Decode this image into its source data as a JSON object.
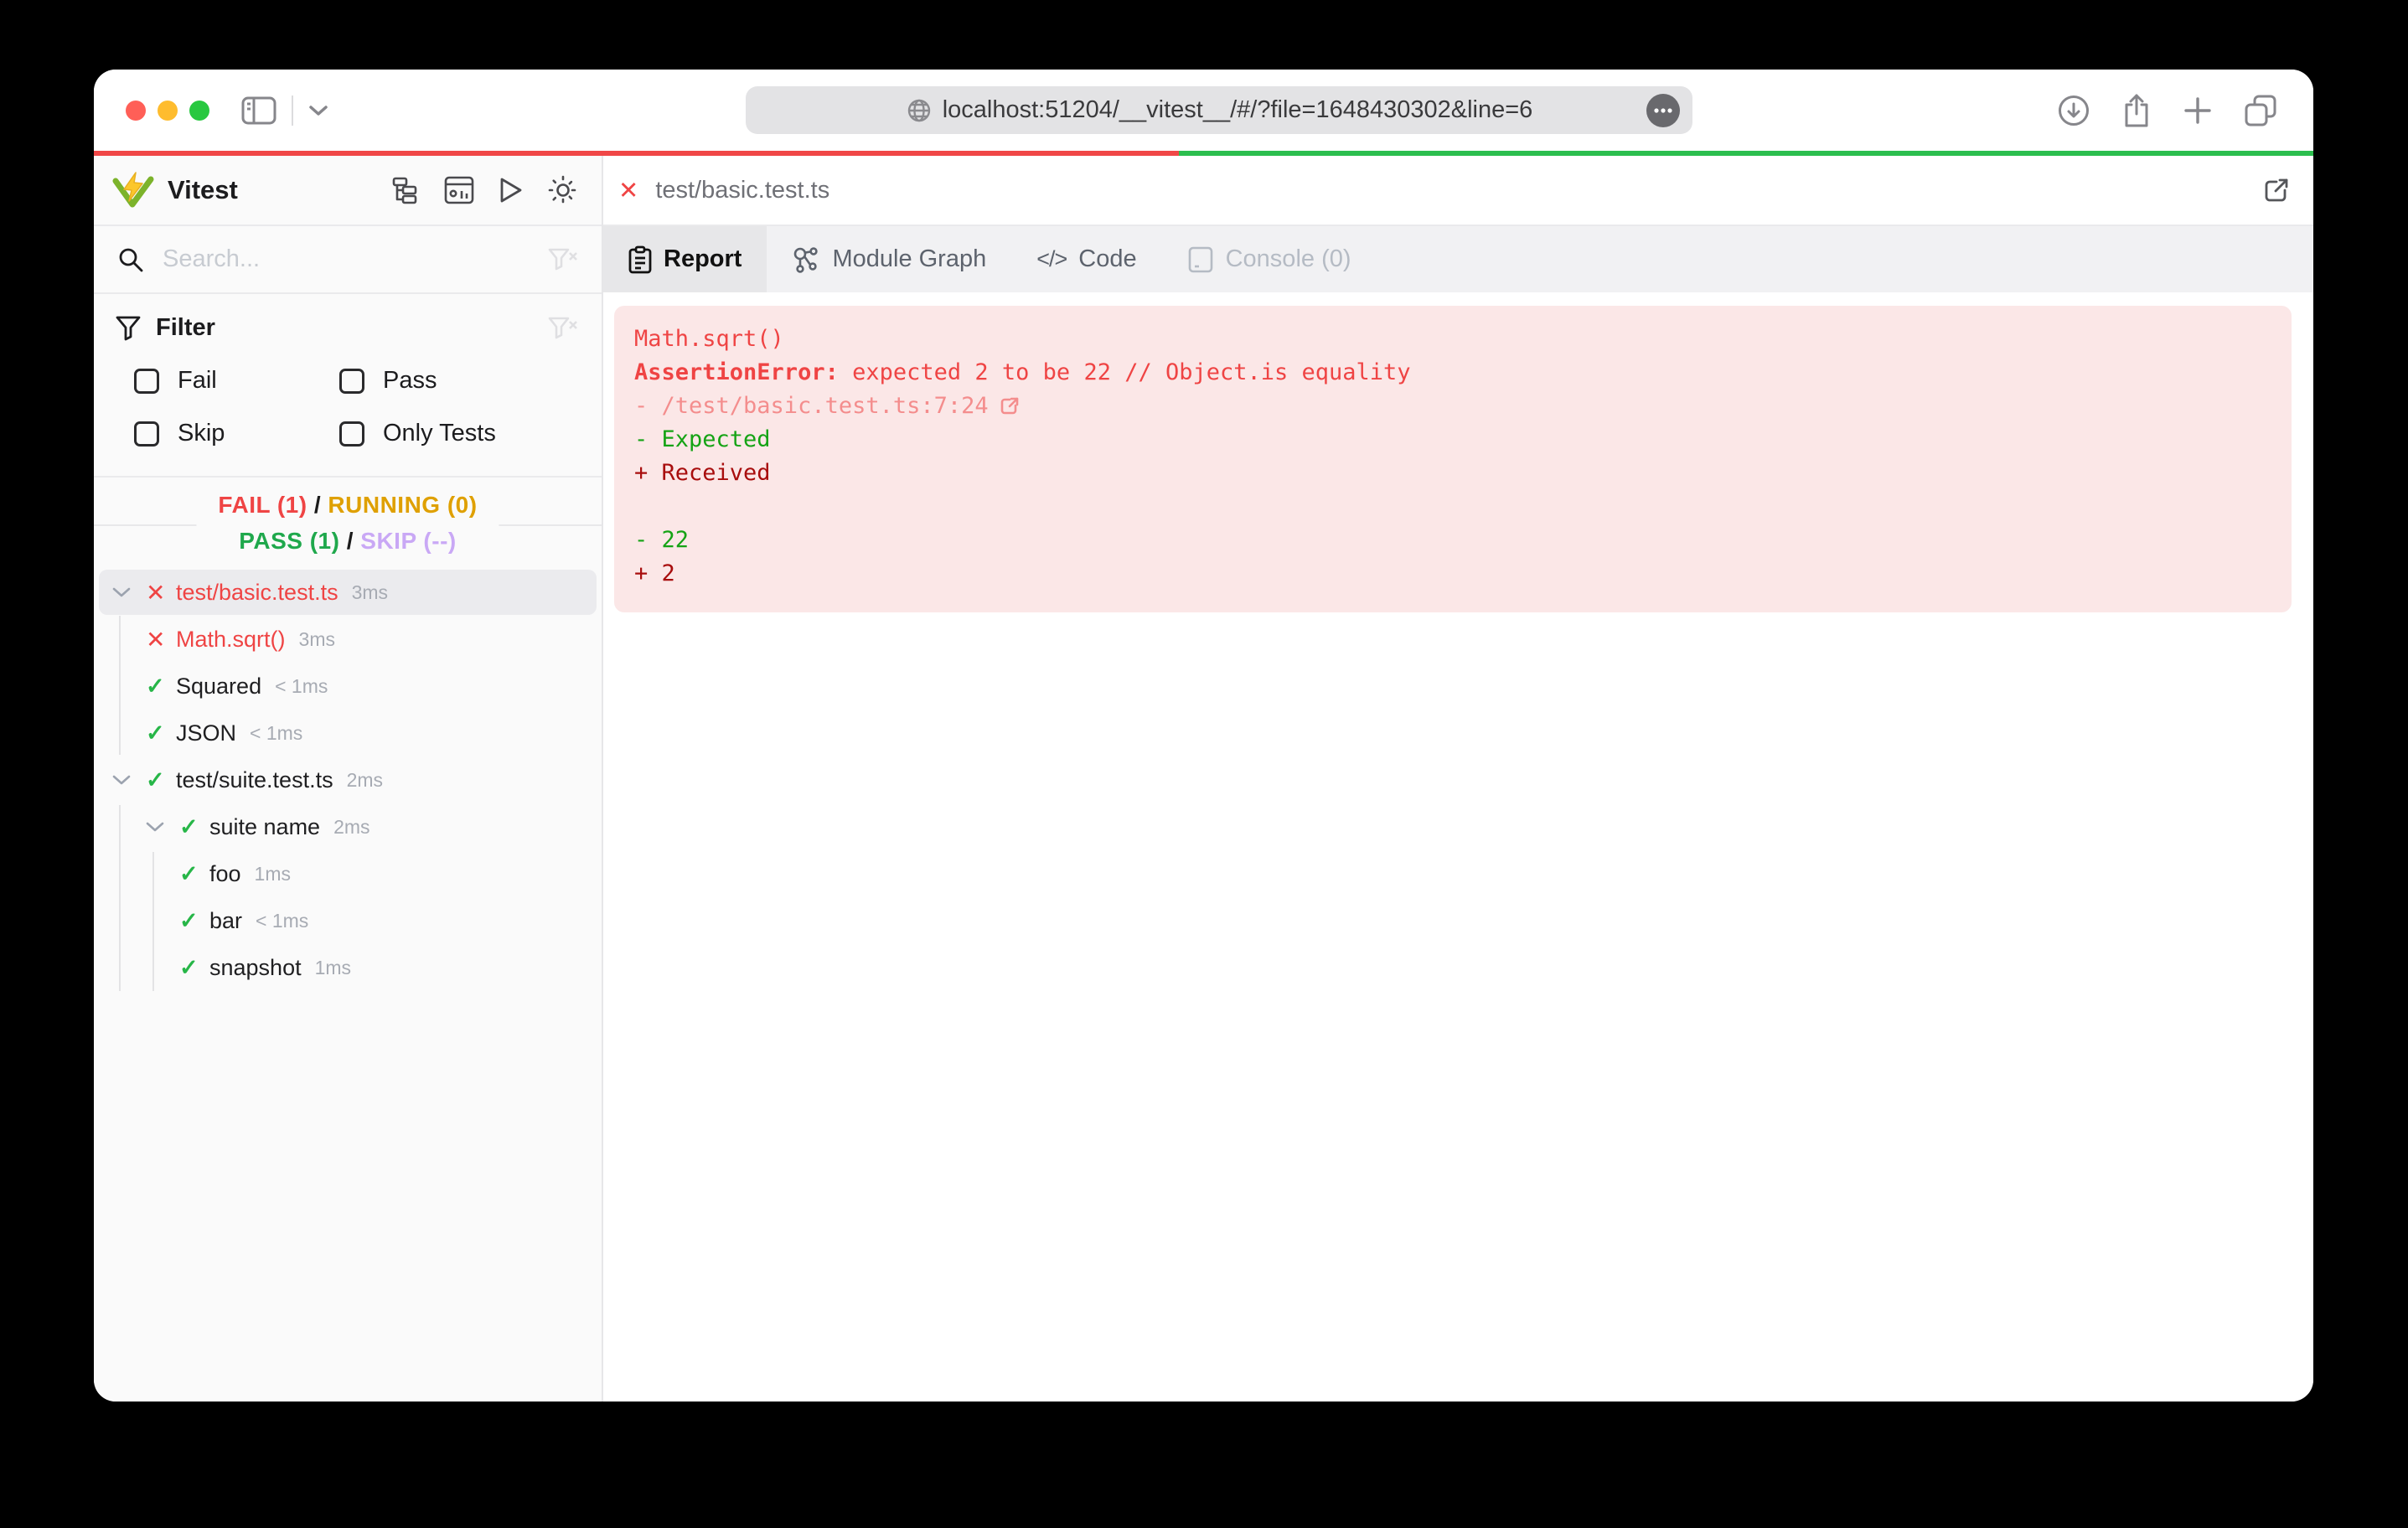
{
  "browser": {
    "url": "localhost:51204/__vitest__/#/?file=1648430302&line=6",
    "traffic_lights": {
      "close": "#ff5f57",
      "minimize": "#febc2e",
      "zoom": "#28c840"
    }
  },
  "progress": {
    "fail_color": "#f04747",
    "pass_color": "#2cbe4e",
    "fail_fraction": "48.9%"
  },
  "sidebar": {
    "app_title": "Vitest",
    "search": {
      "placeholder": "Search..."
    },
    "filter": {
      "title": "Filter",
      "options": [
        {
          "label": "Fail",
          "checked": false
        },
        {
          "label": "Pass",
          "checked": false
        },
        {
          "label": "Skip",
          "checked": false
        },
        {
          "label": "Only Tests",
          "checked": false
        }
      ]
    },
    "summary": {
      "line1": [
        {
          "text": "FAIL (1)",
          "color": "#ef4444"
        },
        {
          "text": " / ",
          "color": "#1b1b1b"
        },
        {
          "text": "RUNNING (0)",
          "color": "#dfa000"
        }
      ],
      "line2": [
        {
          "text": "PASS (1)",
          "color": "#1fa84c"
        },
        {
          "text": " / ",
          "color": "#1b1b1b"
        },
        {
          "text": "SKIP (--)",
          "color": "#c9a8f5"
        }
      ]
    },
    "tree": [
      {
        "label": "test/basic.test.ts",
        "duration": "3ms",
        "status": "fail",
        "level": 0,
        "chevron": true,
        "selected": true
      },
      {
        "label": "Math.sqrt()",
        "duration": "3ms",
        "status": "fail",
        "level": 1,
        "chevron": false,
        "selected": false
      },
      {
        "label": "Squared",
        "duration": "< 1ms",
        "status": "pass",
        "level": 1,
        "chevron": false,
        "selected": false
      },
      {
        "label": "JSON",
        "duration": "< 1ms",
        "status": "pass",
        "level": 1,
        "chevron": false,
        "selected": false
      },
      {
        "label": "test/suite.test.ts",
        "duration": "2ms",
        "status": "pass",
        "level": 0,
        "chevron": true,
        "selected": false
      },
      {
        "label": "suite name",
        "duration": "2ms",
        "status": "pass",
        "level": 1,
        "chevron": true,
        "selected": false
      },
      {
        "label": "foo",
        "duration": "1ms",
        "status": "pass",
        "level": 2,
        "chevron": false,
        "selected": false
      },
      {
        "label": "bar",
        "duration": "< 1ms",
        "status": "pass",
        "level": 2,
        "chevron": false,
        "selected": false
      },
      {
        "label": "snapshot",
        "duration": "1ms",
        "status": "pass",
        "level": 2,
        "chevron": false,
        "selected": false
      }
    ]
  },
  "main": {
    "file_header": {
      "title": "test/basic.test.ts"
    },
    "tabs": [
      {
        "label": "Report",
        "state": "active"
      },
      {
        "label": "Module Graph",
        "state": "normal"
      },
      {
        "label": "Code",
        "state": "normal"
      },
      {
        "label": "Console (0)",
        "state": "disabled"
      }
    ],
    "report": {
      "test_name": "Math.sqrt()",
      "error_name": "AssertionError:",
      "error_message": " expected 2 to be 22 // Object.is equality",
      "stack_line": "- /test/basic.test.ts:7:24",
      "diff_lines": [
        {
          "text": "- Expected",
          "type": "expected"
        },
        {
          "text": "+ Received",
          "type": "received"
        },
        {
          "text": "",
          "type": "blank"
        },
        {
          "text": "- 22",
          "type": "expected"
        },
        {
          "text": "+ 2",
          "type": "received"
        }
      ]
    }
  },
  "colors": {
    "fail": "#ef4444",
    "pass": "#27b648",
    "running": "#dfa000",
    "skip": "#c9a8f5",
    "error_panel_bg": "#fbe7e7",
    "diff_expected": "#15a315",
    "diff_received": "#a80d0d"
  }
}
